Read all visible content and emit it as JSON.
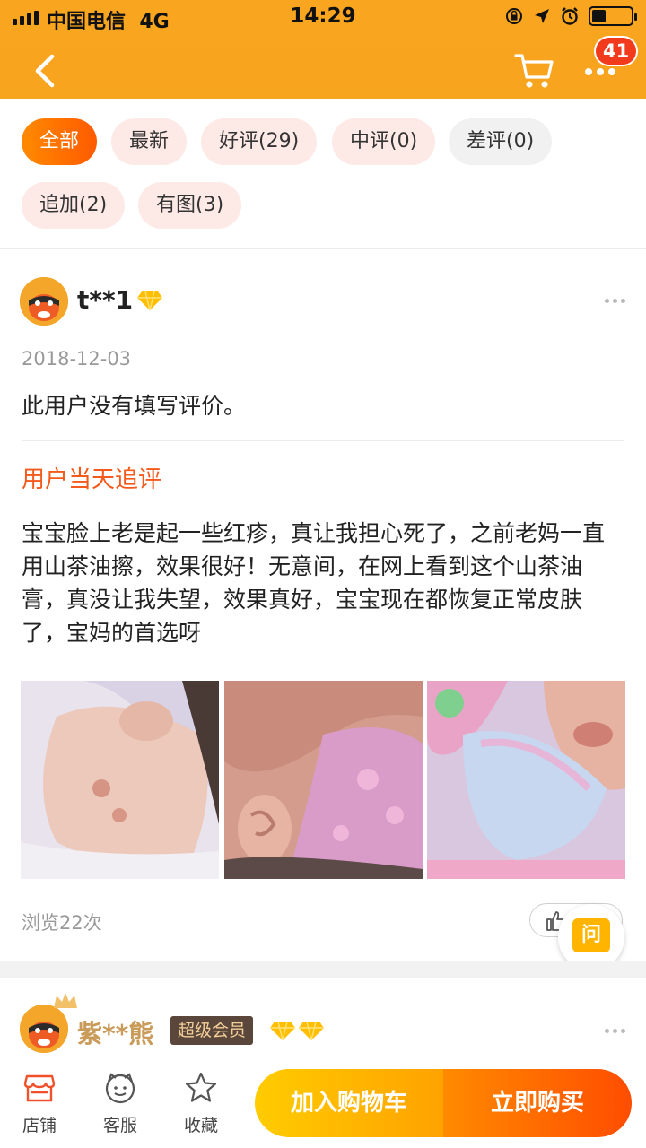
{
  "status_bar": {
    "carrier": "中国电信",
    "network": "4G",
    "time": "14:29",
    "battery_level": 0.35
  },
  "nav": {
    "back_icon": "chevron-left-icon",
    "cart_icon": "cart-icon",
    "more_icon": "more-dots-icon",
    "badge_count": "41"
  },
  "filters": [
    {
      "label": "全部",
      "active": true
    },
    {
      "label": "最新",
      "active": false
    },
    {
      "label": "好评(29)",
      "active": false
    },
    {
      "label": "中评(0)",
      "active": false
    },
    {
      "label": "差评(0)",
      "active": false
    },
    {
      "label": "追加(2)",
      "active": false
    },
    {
      "label": "有图(3)",
      "active": false
    }
  ],
  "review": {
    "username": "t**1",
    "date": "2018-12-03",
    "text": "此用户没有填写评价。",
    "followup_title": "用户当天追评",
    "followup_text": "宝宝脸上老是起一些红疹，真让我担心死了，之前老妈一直用山茶油擦，效果很好！无意间，在网上看到这个山茶油膏，真没让我失望，效果真好，宝宝现在都恢复正常皮肤了，宝妈的首选呀",
    "views": "浏览22次",
    "ask_label": "问"
  },
  "review2": {
    "username": "紫**熊",
    "vip_label": "超级会员"
  },
  "bottom_bar": {
    "tabs": [
      {
        "label": "店铺",
        "icon": "shop-icon"
      },
      {
        "label": "客服",
        "icon": "customer-service-icon"
      },
      {
        "label": "收藏",
        "icon": "star-icon"
      }
    ],
    "add_to_cart": "加入购物车",
    "buy_now": "立即购买"
  },
  "colors": {
    "header_orange": "#f9a51f",
    "accent_orange": "#ff5a00",
    "followup_title": "#f45a1b",
    "vip_gold": "#c99a58"
  }
}
